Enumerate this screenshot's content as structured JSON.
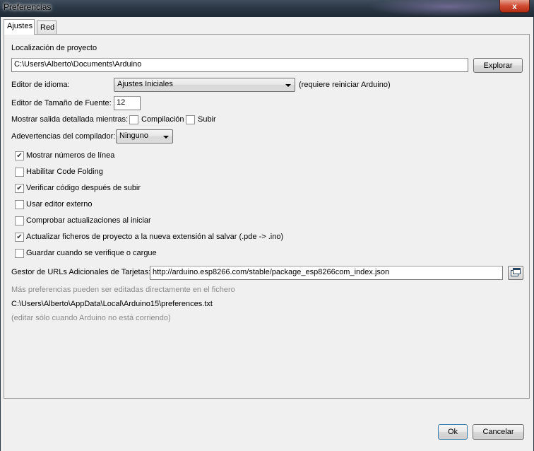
{
  "window": {
    "title": "Preferencias",
    "close_glyph": "x"
  },
  "tabs": [
    {
      "label": "Ajustes"
    },
    {
      "label": "Red"
    }
  ],
  "sketchbook": {
    "label": "Localización de proyecto",
    "path": "C:\\Users\\Alberto\\Documents\\Arduino",
    "browse_label": "Explorar"
  },
  "language": {
    "label": "Editor de idioma:",
    "selected": "Ajustes Iniciales",
    "note": "(requiere reiniciar Arduino)"
  },
  "font_size": {
    "label": "Editor de Tamaño de Fuente:",
    "value": "12"
  },
  "verbose": {
    "label": "Mostrar salida detallada mientras:",
    "compile_label": "Compilación",
    "compile_checked": false,
    "upload_label": "Subir",
    "upload_checked": false
  },
  "warnings": {
    "label": "Adevertencias del compilador:",
    "selected": "Ninguno"
  },
  "options": [
    {
      "label": "Mostrar números de línea",
      "checked": true
    },
    {
      "label": "Habilitar Code Folding",
      "checked": false
    },
    {
      "label": "Verificar código después de subir",
      "checked": true
    },
    {
      "label": "Usar editor externo",
      "checked": false
    },
    {
      "label": "Comprobar actualizaciones al iniciar",
      "checked": false
    },
    {
      "label": "Actualizar ficheros de proyecto a la nueva extensión al salvar (.pde -> .ino)",
      "checked": true
    },
    {
      "label": "Guardar cuando se verifique o cargue",
      "checked": false
    }
  ],
  "boards_urls": {
    "label": "Gestor de URLs Adicionales de Tarjetas:",
    "value": "http://arduino.esp8266.com/stable/package_esp8266com_index.json",
    "open_icon": "window-icon"
  },
  "info": {
    "more_prefs": "Más preferencias pueden ser editadas directamente en el fichero",
    "prefs_path": "C:\\Users\\Alberto\\AppData\\Local\\Arduino15\\preferences.txt",
    "edit_note": "(editar sólo cuando Arduino no está corriendo)"
  },
  "footer": {
    "ok_label": "Ok",
    "cancel_label": "Cancelar"
  }
}
